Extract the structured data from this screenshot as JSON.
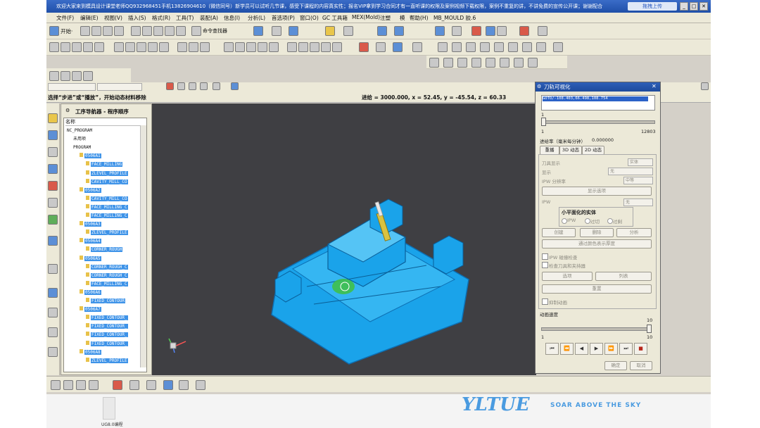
{
  "window": {
    "title": "欢迎大家来到模具设计课堂老师QQ932968451手机13826904610（微信同号）新学员可以试听几节课，感受下课程的内容真实性；报名VIP拿到学习合同才有一直听课的权限及案例视频下载权限，案例不重复的讲，不讲免费的宣传公开课；谢谢配合",
    "badge": "拖拽上传"
  },
  "menu": [
    "文件(F)",
    "编辑(E)",
    "视图(V)",
    "插入(S)",
    "格式(R)",
    "工具(T)",
    "装配(A)",
    "信息(I)",
    "分析(L)",
    "首选项(P)",
    "窗口(O)",
    "GC 工具箱",
    "MEX(Mold)",
    "注塑",
    "模",
    "帮助(H)",
    "MB_MOULD 胶.6"
  ],
  "toolbar": {
    "start_label": "开始·",
    "command_finder": "命令查找器"
  },
  "cue": {
    "prompt": "选择“步进”或“播放”，开始动态材料移除",
    "status": "进给 = 3000.000, x = 52.45, y = -45.54, z = 60.33"
  },
  "navigator": {
    "title": "工序导航器 - 程序顺序",
    "column": "名称",
    "rows": [
      {
        "label": "NC_PROGRAM",
        "depth": 0,
        "hi": false
      },
      {
        "label": "未用项",
        "depth": 1,
        "hi": false
      },
      {
        "label": "PROGRAM",
        "depth": 1,
        "hi": false
      },
      {
        "label": "0506A1",
        "depth": 2,
        "hi": true
      },
      {
        "label": "FACE_MILLING",
        "depth": 3,
        "hi": true
      },
      {
        "label": "ZLEVEL_PROFILE",
        "depth": 3,
        "hi": true
      },
      {
        "label": "CAVITY_MILL_CO",
        "depth": 3,
        "hi": true
      },
      {
        "label": "0506A2",
        "depth": 2,
        "hi": true
      },
      {
        "label": "CAVITY_MILL_CO",
        "depth": 3,
        "hi": true
      },
      {
        "label": "FACE_MILLING_C",
        "depth": 3,
        "hi": true
      },
      {
        "label": "FACE_MILLING_C",
        "depth": 3,
        "hi": true
      },
      {
        "label": "0506A3",
        "depth": 2,
        "hi": true
      },
      {
        "label": "ZLEVEL_PROFILE",
        "depth": 3,
        "hi": true
      },
      {
        "label": "0506A4",
        "depth": 2,
        "hi": true
      },
      {
        "label": "CORNER_ROUGH",
        "depth": 3,
        "hi": true
      },
      {
        "label": "0506A5",
        "depth": 2,
        "hi": true
      },
      {
        "label": "CORNER_ROUGH_C",
        "depth": 3,
        "hi": true
      },
      {
        "label": "CORNER_ROUGH_C",
        "depth": 3,
        "hi": true
      },
      {
        "label": "FACE_MILLING_C",
        "depth": 3,
        "hi": true
      },
      {
        "label": "0506A6",
        "depth": 2,
        "hi": true
      },
      {
        "label": "FIXED_CONTOUR",
        "depth": 3,
        "hi": true
      },
      {
        "label": "0506A7",
        "depth": 2,
        "hi": true
      },
      {
        "label": "FIXED_CONTOUR_",
        "depth": 3,
        "hi": true
      },
      {
        "label": "FIXED_CONTOUR_",
        "depth": 3,
        "hi": true
      },
      {
        "label": "FIXED_CONTOUR_",
        "depth": 3,
        "hi": true
      },
      {
        "label": "FIXED_CONTOUR_",
        "depth": 3,
        "hi": true
      },
      {
        "label": "0506A8",
        "depth": 2,
        "hi": true
      },
      {
        "label": "ZLEVEL_PROFILE",
        "depth": 3,
        "hi": true
      }
    ]
  },
  "dialog": {
    "title": "刀轨可视化",
    "list_item": "GOTO/-108.403,66.498,108.754",
    "slider_value": "1",
    "slider_min": "1",
    "slider_max": "12803",
    "feed_label": "进给率（毫米每分钟）",
    "feed_value": "0.000000",
    "tabs": [
      "重播",
      "3D 动态",
      "2D 动态"
    ],
    "tool_display_label": "刀具显示",
    "tool_display_value": "实体",
    "display_label": "显示",
    "display_value": "无",
    "ipw_res_label": "IPW 分辨率",
    "ipw_res_value": "中等",
    "show_options": "显示选项",
    "ipw_label": "IPW",
    "ipw_value": "无",
    "small_facet_title": "小平面化的实体",
    "radio_ipw": "IPW",
    "radio_cut": "过切",
    "radio_overcut": "过剩",
    "btn_create": "创建",
    "btn_delete": "删除",
    "btn_analyze": "分析",
    "btn_color": "通过颜色表示厚度",
    "chk_ipw_collision": "IPW 碰撞检查",
    "chk_tool_holder": "检查刀具和夹持器",
    "btn_options": "选项",
    "btn_list": "列表",
    "btn_reset": "重置",
    "chk_suppress": "抑制动画",
    "anim_label": "动画速度",
    "anim_max": "10",
    "anim_min": "1",
    "anim_current": "10",
    "anim_fraction": 1.0,
    "playback": [
      "⏮",
      "⏪",
      "◀",
      "▶",
      "⏩",
      "⏭",
      "■"
    ],
    "ok": "确定",
    "cancel": "取消"
  },
  "taskbar": {
    "logo": "YLTUE",
    "slogan": "SOAR ABOVE THE SKY",
    "task_label": "UG8.0编程"
  },
  "colors": {
    "mold": "#1aa3ea",
    "viewport_bg": "#3f3f43",
    "selection": "#3e93e8",
    "title": "#2e5fb8"
  }
}
